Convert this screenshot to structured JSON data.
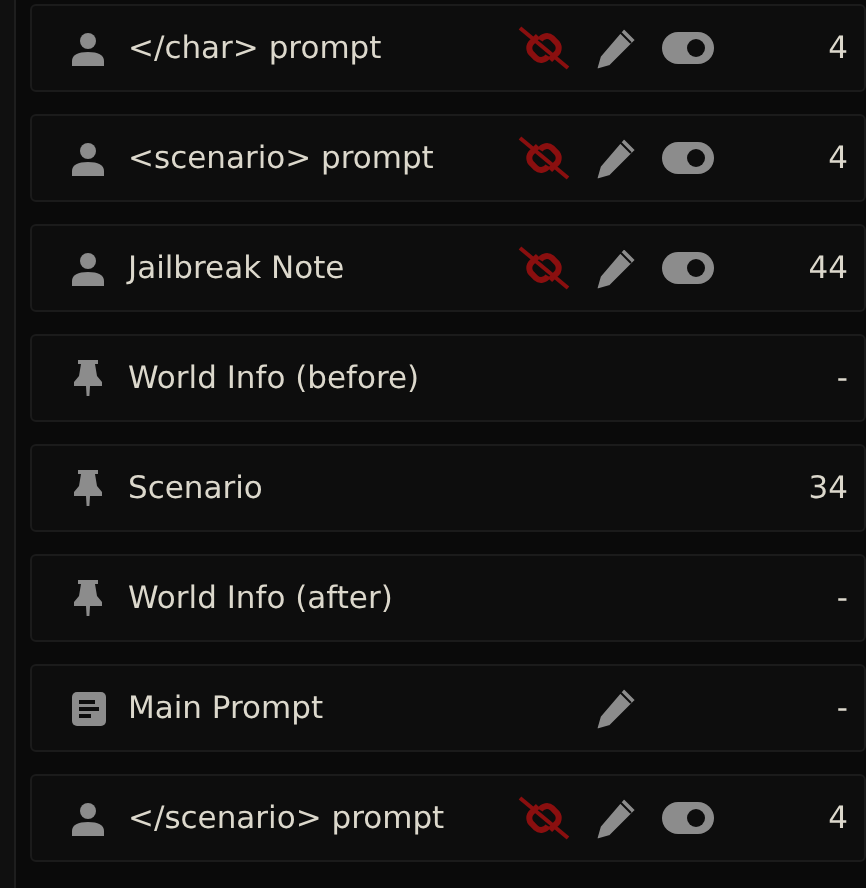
{
  "prompts": [
    {
      "kind": "user",
      "name": "</char> prompt",
      "forbid_overrides": true,
      "editable": true,
      "enabled": true,
      "tokens": "4"
    },
    {
      "kind": "user",
      "name": "<scenario> prompt",
      "forbid_overrides": true,
      "editable": true,
      "enabled": true,
      "tokens": "4"
    },
    {
      "kind": "user",
      "name": "Jailbreak Note",
      "forbid_overrides": true,
      "editable": true,
      "enabled": true,
      "tokens": "44"
    },
    {
      "kind": "pin",
      "name": "World Info (before)",
      "tokens": "-"
    },
    {
      "kind": "pin",
      "name": "Scenario",
      "tokens": "34"
    },
    {
      "kind": "pin",
      "name": "World Info (after)",
      "tokens": "-"
    },
    {
      "kind": "doc",
      "name": "Main Prompt",
      "editable": true,
      "tokens": "-"
    },
    {
      "kind": "user",
      "name": "</scenario> prompt",
      "forbid_overrides": true,
      "editable": true,
      "enabled": true,
      "tokens": "4"
    }
  ]
}
